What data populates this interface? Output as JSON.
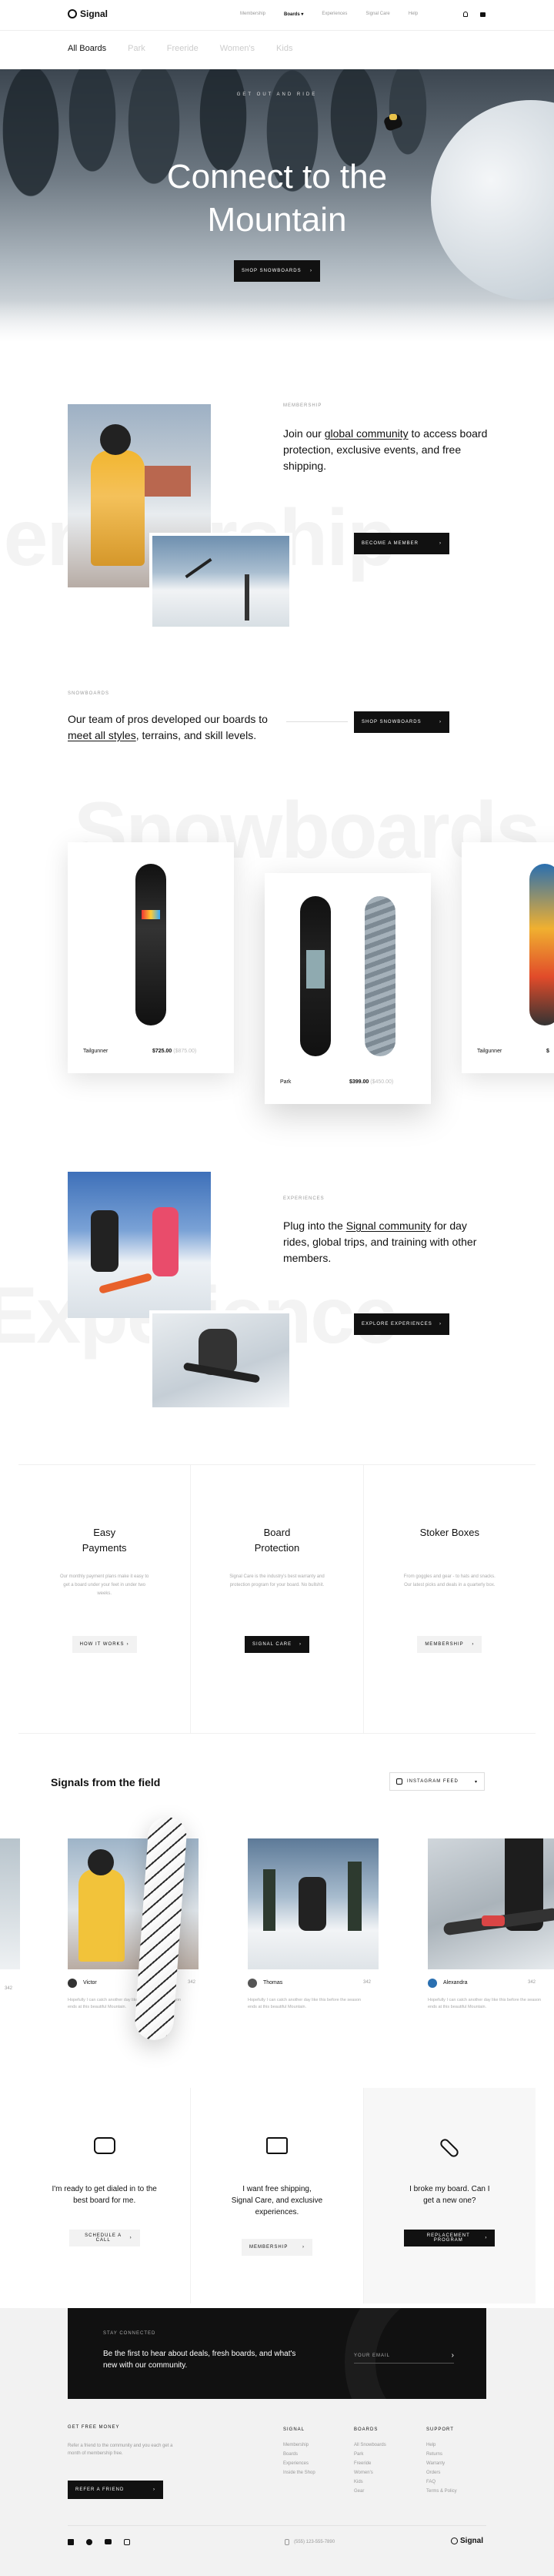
{
  "nav": {
    "brand": "Signal",
    "links": [
      "Membership",
      "Boards",
      "Experiences",
      "Signal Care",
      "Help"
    ],
    "subnav": [
      "All Boards",
      "Park",
      "Freeride",
      "Women's",
      "Kids"
    ]
  },
  "hero": {
    "eyebrow": "GET OUT AND RIDE",
    "title_line1": "Connect to the",
    "title_line2": "Mountain",
    "cta": "SHOP SNOWBOARDS"
  },
  "membership": {
    "eyebrow": "MEMBERSHIP",
    "text_before": "Join our ",
    "text_link": "global community",
    "text_after": " to access board protection, exclusive events, and free shipping.",
    "cta": "BECOME A MEMBER",
    "ghost": "Membership"
  },
  "snowboards": {
    "eyebrow": "SNOWBOARDS",
    "text_before": "Our team of pros developed our boards to ",
    "text_link": "meet all styles",
    "text_after": ", terrains, and skill levels.",
    "cta": "SHOP SNOWBOARDS",
    "ghost": "Snowboards",
    "products": [
      {
        "name": "Tailgunner",
        "price": "$725.00",
        "old": "($875.00)"
      },
      {
        "name": "Park",
        "price": "$399.00",
        "old": "($450.00)"
      },
      {
        "name": "Tailgunner",
        "price": "$"
      }
    ]
  },
  "experiences": {
    "eyebrow": "EXPERIENCES",
    "text_before": "Plug into the ",
    "text_link": "Signal community",
    "text_after": " for day rides, global trips, and training with other members.",
    "cta": "EXPLORE EXPERIENCES",
    "ghost": "Experience"
  },
  "features": [
    {
      "title": "Easy Payments",
      "body": "Our monthly payment plans make it easy to get a board under your feet in under two weeks.",
      "cta": "HOW IT WORKS"
    },
    {
      "title": "Board Protection",
      "body": "Signal Care is the industry's best warranty and protection program for your board. No bullshit.",
      "cta": "SIGNAL CARE"
    },
    {
      "title": "Stoker Boxes",
      "body": "From goggles and gear - to hats and snacks. Our latest picks and deals in a quarterly box.",
      "cta": "MEMBERSHIP"
    }
  ],
  "field": {
    "title": "Signals from the field",
    "instagram": "INSTAGRAM FEED",
    "posts": [
      {
        "user": "Victor",
        "likes": "342",
        "caption": "Hopefully I can catch another day like this before the season ends at this beautiful Mountain."
      },
      {
        "user": "Thomas",
        "likes": "342",
        "caption": "Hopefully I can catch another day like this before the season ends at this beautiful Mountain."
      },
      {
        "user": "Alexandra",
        "likes": "342",
        "caption": "Hopefully I can catch another day like this before the season ends at this beautiful Mountain."
      }
    ],
    "edge_likes_left": "342",
    "edge_likes_right": "342"
  },
  "help": [
    {
      "text": "I'm ready to get dialed in to the best board for me.",
      "cta": "SCHEDULE A CALL",
      "icon": "chat-icon"
    },
    {
      "text": "I want free shipping, Signal Care, and exclusive experiences.",
      "cta": "MEMBERSHIP",
      "icon": "card-icon"
    },
    {
      "text": "I broke my board. Can I get a new one?",
      "cta": "REPLACEMENT PROGRAM",
      "icon": "broken-board-icon"
    }
  ],
  "newsletter": {
    "eyebrow": "STAY CONNECTED",
    "text": "Be the first to hear about deals, fresh boards, and what's new with our community.",
    "placeholder": "YOUR EMAIL"
  },
  "footer": {
    "free_money_title": "GET FREE MONEY",
    "free_money_body": "Refer a friend to the community and you each get a month of membership free.",
    "refer_cta": "REFER A FRIEND",
    "cols": [
      {
        "title": "SIGNAL",
        "items": [
          "Membership",
          "Boards",
          "Experiences",
          "Inside the Shop"
        ]
      },
      {
        "title": "BOARDS",
        "items": [
          "All Snowboards",
          "Park",
          "Freeride",
          "Women's",
          "Kids",
          "Gear"
        ]
      },
      {
        "title": "SUPPORT",
        "items": [
          "Help",
          "Returns",
          "Warranty",
          "Orders",
          "FAQ",
          "Terms & Policy"
        ]
      }
    ],
    "phone": "(555) 123-555-7890",
    "brand": "Signal"
  }
}
